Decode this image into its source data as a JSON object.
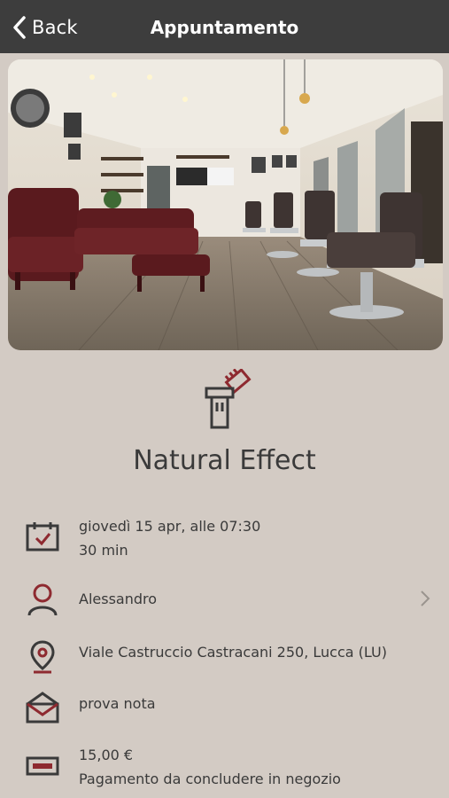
{
  "header": {
    "back_label": "Back",
    "title": "Appuntamento"
  },
  "hero": {
    "alt": "barbershop interior"
  },
  "service": {
    "name": "Natural Effect",
    "icon": "barber-clipper-icon"
  },
  "details": {
    "datetime": "giovedì 15 apr, alle 07:30",
    "duration": "30 min",
    "staff": "Alessandro",
    "address": "Viale Castruccio Castracani 250, Lucca (LU)",
    "note": "prova nota",
    "price": "15,00 €",
    "payment": "Pagamento da concludere in negozio"
  },
  "colors": {
    "accent": "#8e2a30",
    "background": "#d3cbc4",
    "topbar": "#3d3d3d"
  }
}
